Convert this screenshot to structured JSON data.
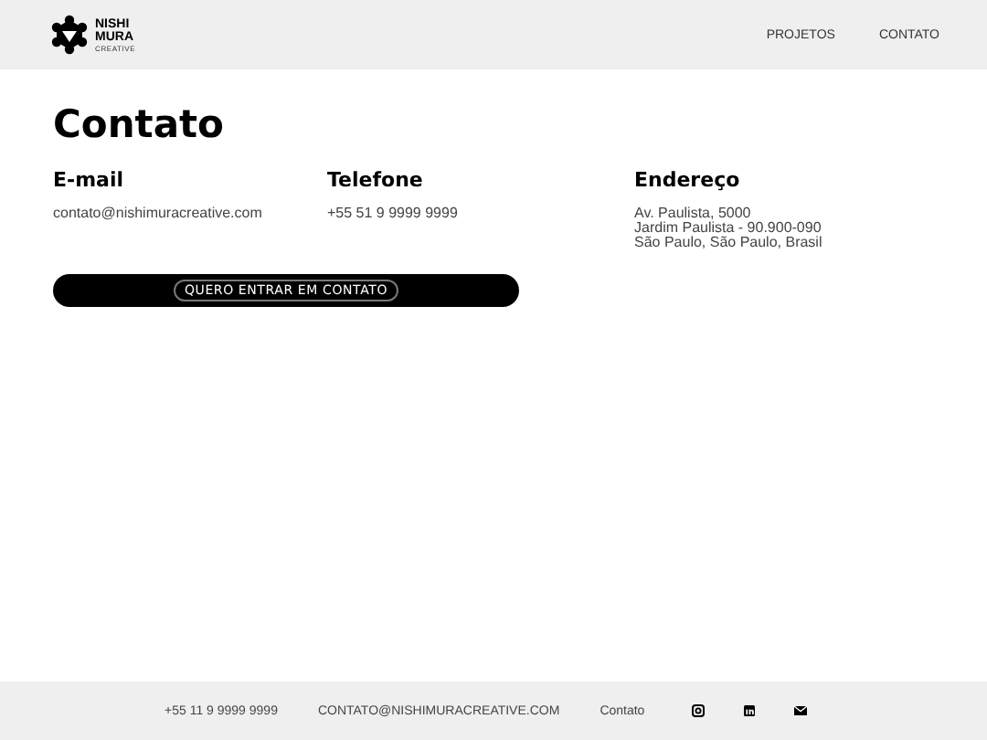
{
  "header": {
    "logo": {
      "lines": [
        "NISHI",
        "MURA",
        "CREATIVE"
      ]
    },
    "nav": [
      "PROJETOS",
      "CONTATO"
    ]
  },
  "title": "Contato",
  "columns": [
    {
      "heading": "E-mail",
      "lines": [
        "contato@nishimuracreative.com"
      ]
    },
    {
      "heading": "Telefone",
      "lines": [
        "+55 51 9 9999 9999"
      ]
    },
    {
      "heading": "Endereço",
      "lines": [
        "Av. Paulista, 5000",
        "Jardim Paulista - 90.900-090",
        "São Paulo, São Paulo, Brasil"
      ]
    }
  ],
  "cta_button": "QUERO ENTRAR EM CONTATO",
  "footer": {
    "links": [
      "+55 11 9 9999 9999",
      "CONTATO@NISHIMURACREATIVE.COM",
      "Contato"
    ],
    "social": [
      {
        "kind": "instagram"
      },
      {
        "kind": "linkedin"
      },
      {
        "kind": "email"
      }
    ]
  }
}
